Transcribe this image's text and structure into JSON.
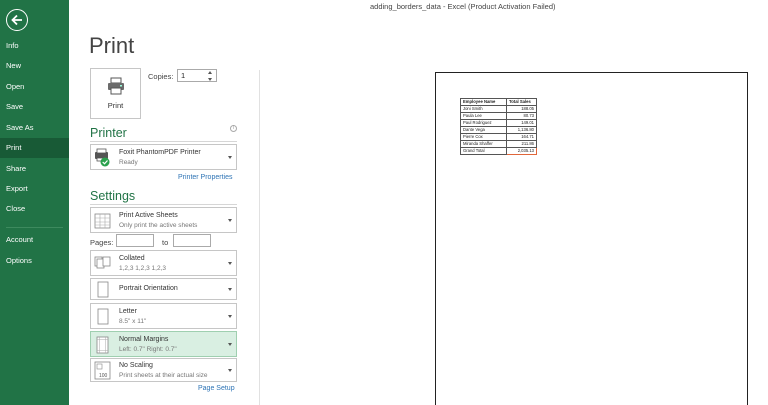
{
  "window": {
    "title": "adding_borders_data - Excel (Product Activation Failed)"
  },
  "sidebar": {
    "items": [
      {
        "label": "Info",
        "active": false
      },
      {
        "label": "New",
        "active": false
      },
      {
        "label": "Open",
        "active": false
      },
      {
        "label": "Save",
        "active": false
      },
      {
        "label": "Save As",
        "active": false
      },
      {
        "label": "Print",
        "active": true
      },
      {
        "label": "Share",
        "active": false
      },
      {
        "label": "Export",
        "active": false
      },
      {
        "label": "Close",
        "active": false
      },
      {
        "label": "Account",
        "active": false
      },
      {
        "label": "Options",
        "active": false
      }
    ]
  },
  "print": {
    "title": "Print",
    "button_label": "Print",
    "copies_label": "Copies:",
    "copies_value": "1"
  },
  "printer": {
    "section_title": "Printer",
    "name": "Foxit PhantomPDF Printer",
    "status": "Ready",
    "properties_link": "Printer Properties"
  },
  "settings": {
    "section_title": "Settings",
    "scope_main": "Print Active Sheets",
    "scope_sub": "Only print the active sheets",
    "pages_label": "Pages:",
    "pages_to_label": "to",
    "collate_main": "Collated",
    "collate_sub": "1,2,3    1,2,3    1,2,3",
    "orientation_main": "Portrait Orientation",
    "paper_main": "Letter",
    "paper_sub": "8.5\" x 11\"",
    "margins_main": "Normal Margins",
    "margins_sub": "Left: 0.7\"    Right: 0.7\"",
    "scaling_main": "No Scaling",
    "scaling_sub": "Print sheets at their actual size",
    "page_setup_link": "Page Setup"
  },
  "preview": {
    "headers": [
      "Employee Name",
      "Total Sales"
    ],
    "rows": [
      [
        "Joni Smith",
        "188.05"
      ],
      [
        "Paula Lee",
        "80.73"
      ],
      [
        "Paul Rodriguez",
        "149.01"
      ],
      [
        "Dante Vega",
        "1,136.80"
      ],
      [
        "Pierre Cox",
        "164.71"
      ],
      [
        "Miranda Shaffer",
        "211.86"
      ],
      [
        "Grand Total",
        "2,035.13"
      ]
    ]
  },
  "colors": {
    "accent": "#217346",
    "accent_dark": "#185a36",
    "link": "#2e74b5"
  }
}
